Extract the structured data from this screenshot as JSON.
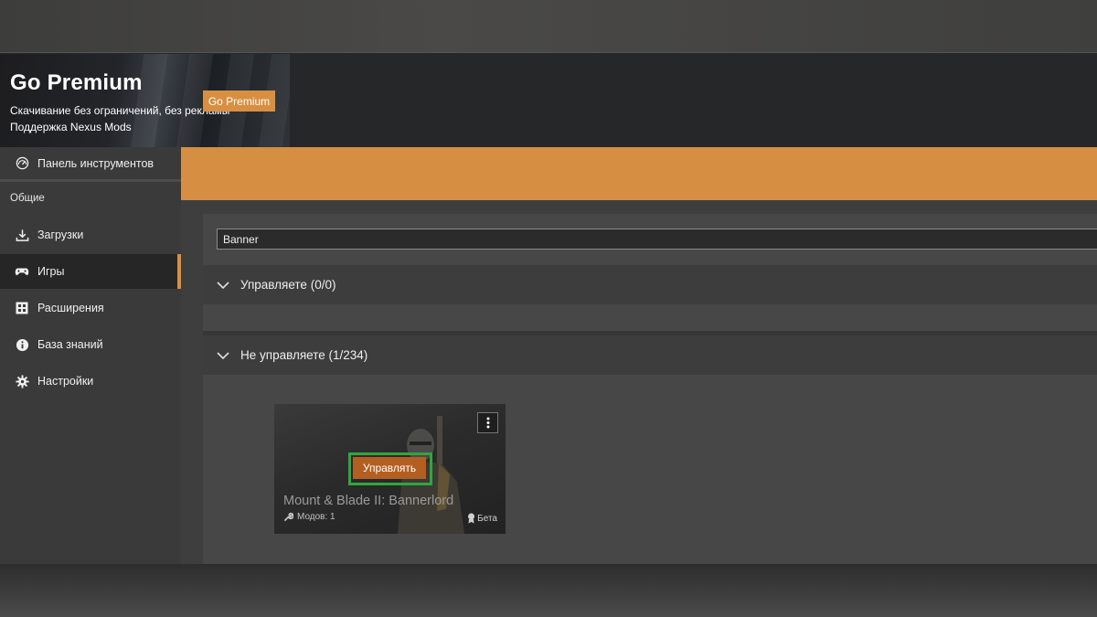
{
  "promo": {
    "title": "Go Premium",
    "line1": "Скачивание без ограничений, без рекламы",
    "line2": "Поддержка Nexus Mods",
    "button": "Go Premium"
  },
  "sidebar": {
    "dashboard": "Панель инструментов",
    "section_header": "Общие",
    "items": [
      {
        "label": "Загрузки",
        "icon": "download-icon"
      },
      {
        "label": "Игры",
        "icon": "gamepad-icon",
        "active": true
      },
      {
        "label": "Расширения",
        "icon": "extensions-icon"
      },
      {
        "label": "База знаний",
        "icon": "info-icon"
      },
      {
        "label": "Настройки",
        "icon": "gear-icon"
      }
    ]
  },
  "search": {
    "value": "Banner"
  },
  "sections": {
    "managed": "Управляете (0/0)",
    "unmanaged": "Не управляете (1/234)"
  },
  "game": {
    "title": "Mount & Blade II: Bannerlord",
    "manage_button": "Управлять",
    "mods": "Модов: 1",
    "badge": "Бета"
  },
  "colors": {
    "accent": "#d98f40",
    "highlight": "#2fa640",
    "manage_button": "#b35f22"
  }
}
